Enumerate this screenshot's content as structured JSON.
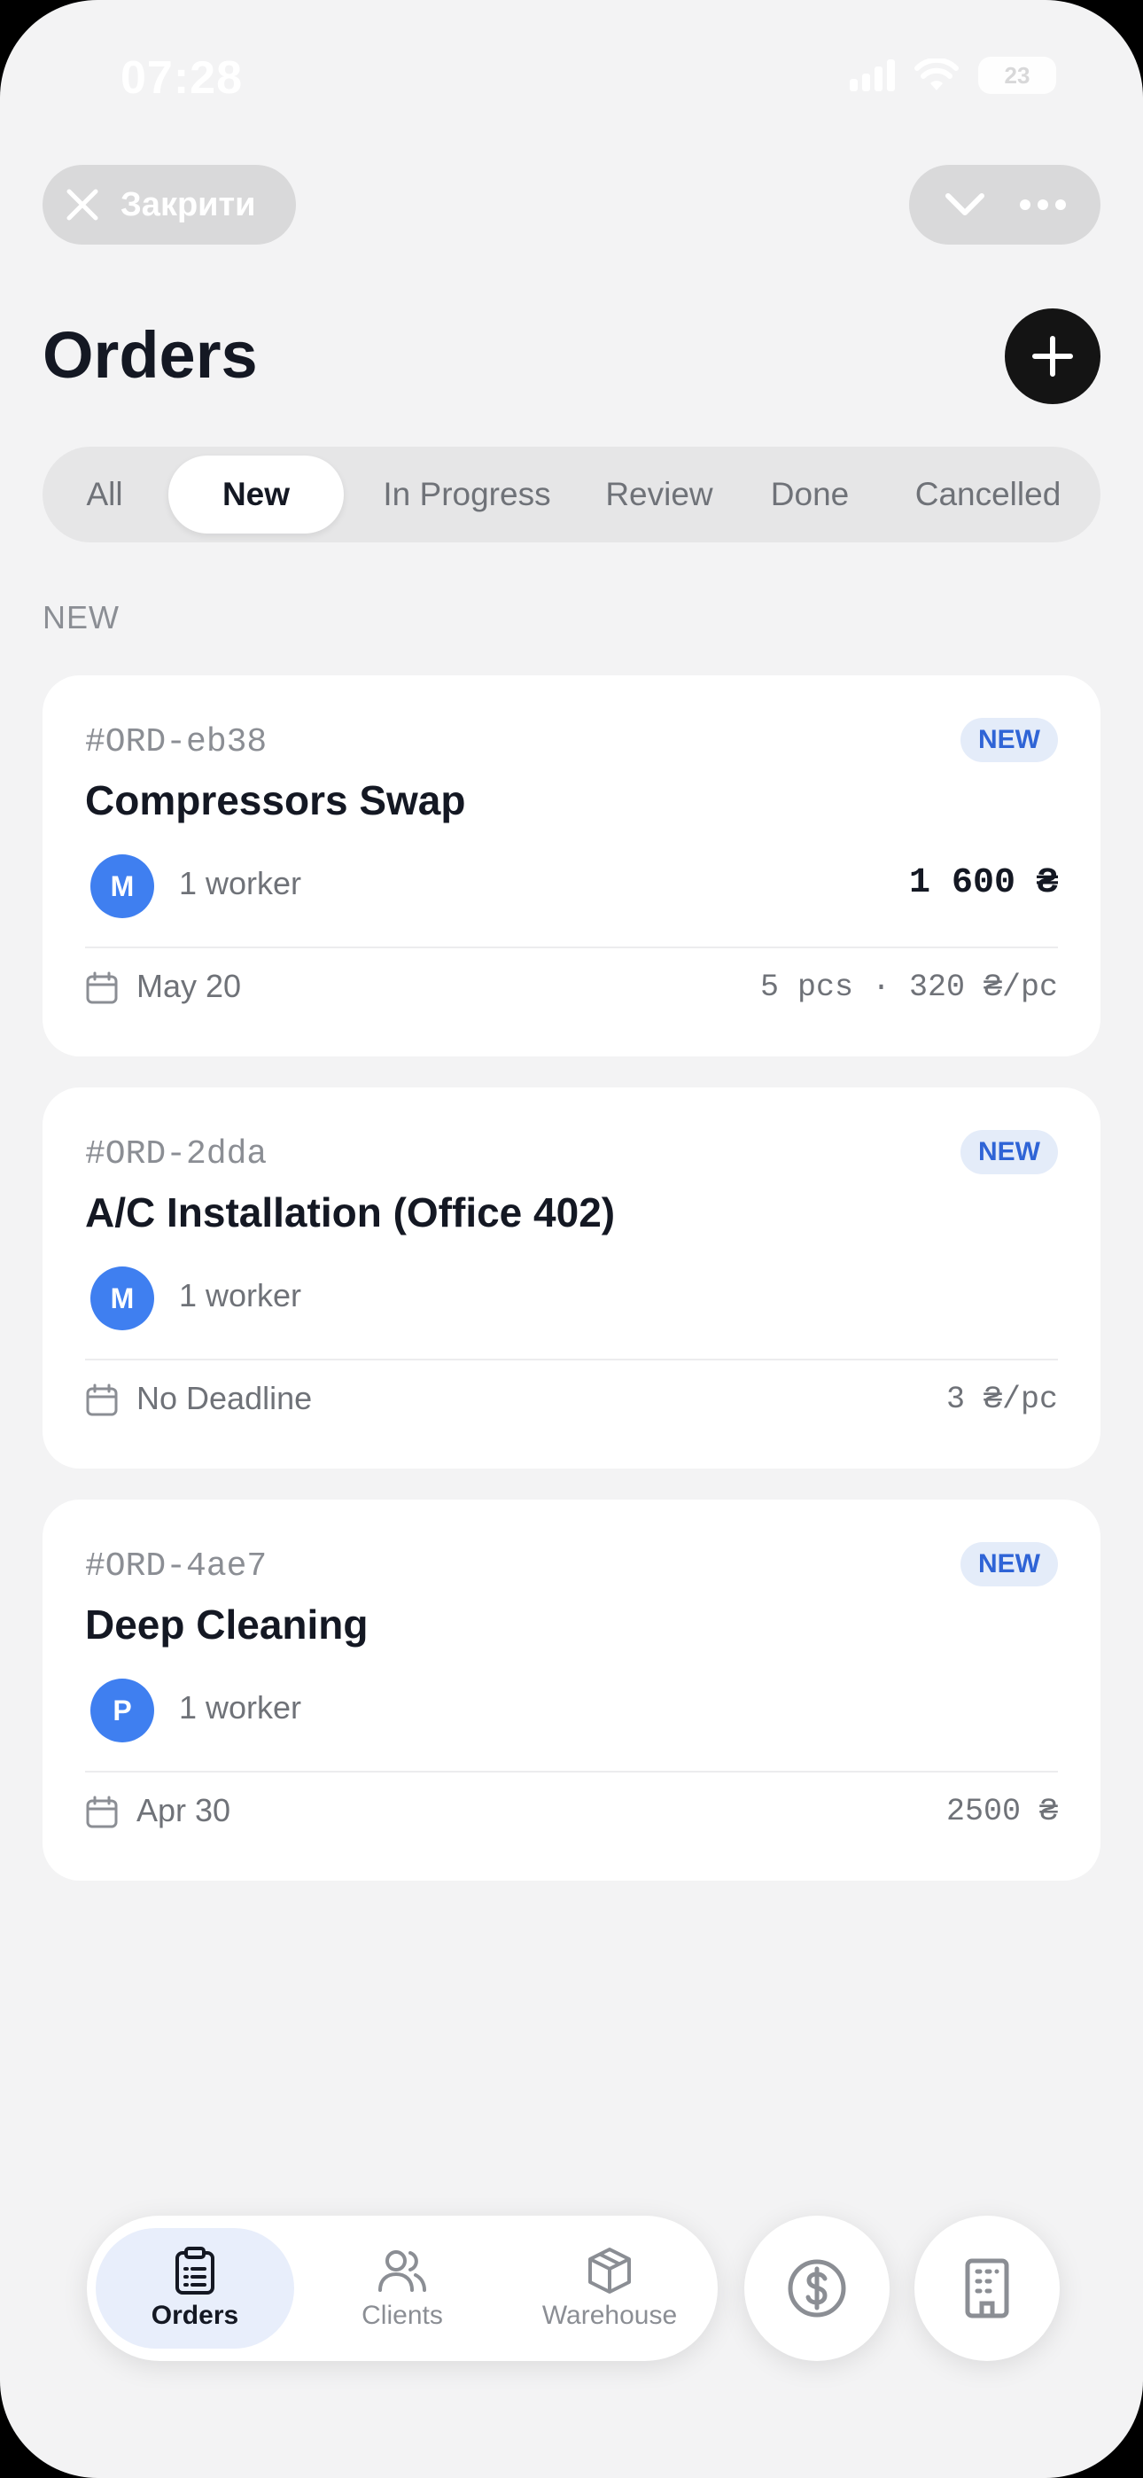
{
  "status_bar": {
    "time": "07:28",
    "battery": "23"
  },
  "header": {
    "close_label": "Закрити",
    "title": "Orders"
  },
  "tabs": [
    {
      "label": "All",
      "active": false
    },
    {
      "label": "New",
      "active": true
    },
    {
      "label": "In Progress",
      "active": false
    },
    {
      "label": "Review",
      "active": false
    },
    {
      "label": "Done",
      "active": false
    },
    {
      "label": "Cancelled",
      "active": false
    }
  ],
  "section_label": "NEW",
  "orders": [
    {
      "code": "#ORD-eb38",
      "status": "NEW",
      "title": "Compressors Swap",
      "avatar": "M",
      "workers": "1 worker",
      "total": "1 600 ₴",
      "date": "May 20",
      "meta": "5 pcs · 320 ₴/pc"
    },
    {
      "code": "#ORD-2dda",
      "status": "NEW",
      "title": "A/C Installation (Office 402)",
      "avatar": "M",
      "workers": "1 worker",
      "total": "",
      "date": "No Deadline",
      "meta": "3 ₴/pc"
    },
    {
      "code": "#ORD-4ae7",
      "status": "NEW",
      "title": "Deep Cleaning",
      "avatar": "P",
      "workers": "1 worker",
      "total": "",
      "date": "Apr 30",
      "meta": "2500 ₴"
    }
  ],
  "bottom_nav": {
    "items": [
      {
        "label": "Orders",
        "icon": "clipboard-icon",
        "active": true
      },
      {
        "label": "Clients",
        "icon": "users-icon",
        "active": false
      },
      {
        "label": "Warehouse",
        "icon": "box-icon",
        "active": false
      }
    ],
    "extra_buttons": [
      "dollar-icon",
      "building-icon"
    ]
  },
  "colors": {
    "background": "#f3f3f4",
    "accent_blue": "#3f7ff0",
    "badge_text": "#2f64d6",
    "badge_bg": "#e4ecf9",
    "primary_dark": "#141414"
  }
}
